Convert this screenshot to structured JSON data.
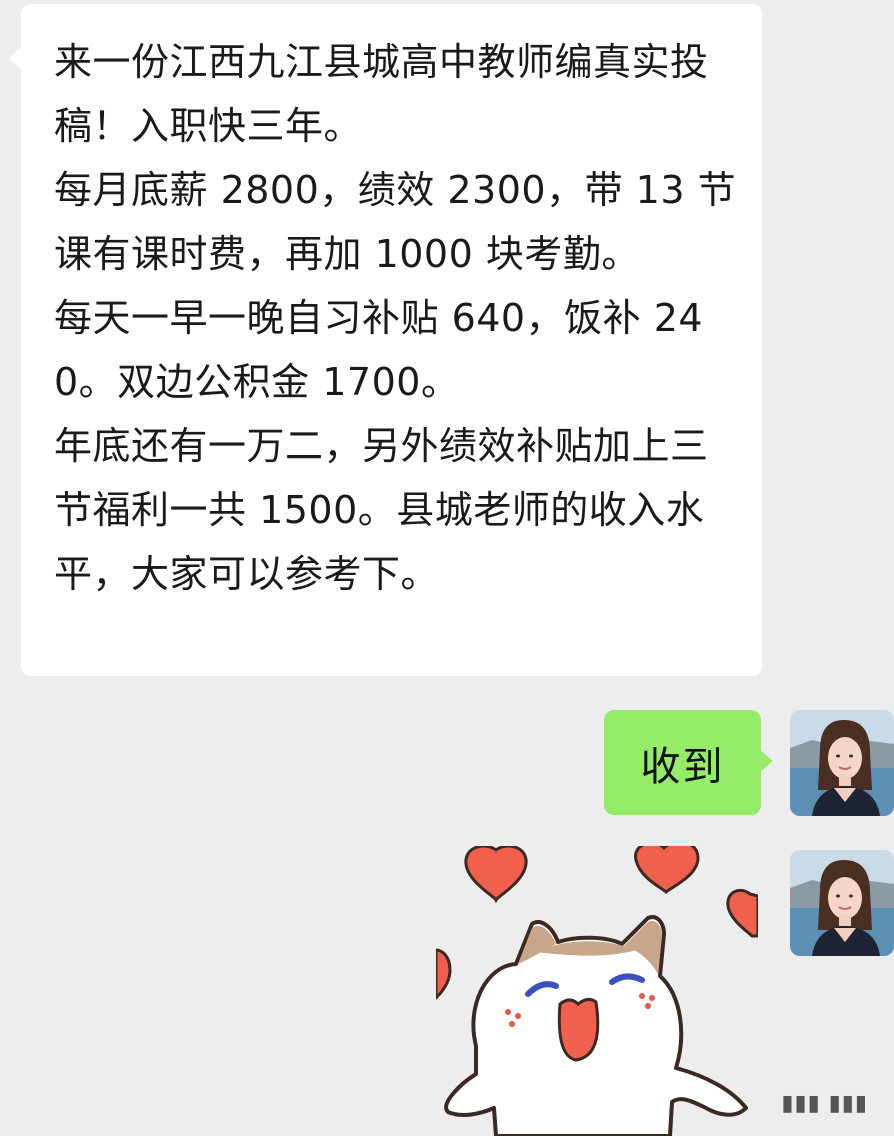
{
  "chat": {
    "incoming": {
      "text": "来一份江西九江县城高中教师编真实投稿！入职快三年。\n每月底薪 2800，绩效 2300，带 13 节课有课时费，再加 1000 块考勤。\n每天一早一晚自习补贴 640，饭补 240。双边公积金 1700。\n年底还有一万二，另外绩效补贴加上三节福利一共 1500。县城老师的收入水平，大家可以参考下。"
    },
    "outgoing": {
      "reply": "收到",
      "sticker_icon": "cat-with-hearts-sticker"
    },
    "avatar_icon": "user-avatar-woman"
  },
  "colors": {
    "background": "#ededed",
    "incoming_bubble": "#ffffff",
    "outgoing_bubble": "#95ec69",
    "heart": "#f0604d"
  }
}
